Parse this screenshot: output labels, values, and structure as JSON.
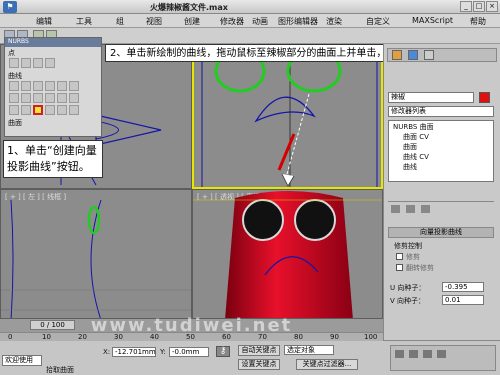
{
  "window": {
    "title": "火爆辣椒酱文件.max",
    "controls": [
      "_",
      "□",
      "×"
    ]
  },
  "menu": [
    "编辑",
    "工具",
    "组",
    "视图",
    "创建",
    "修改器",
    "动画",
    "图形编辑器",
    "渲染",
    "自定义",
    "MAXScript",
    "帮助"
  ],
  "palette": {
    "title": "NURBS",
    "sections": [
      "点",
      "曲线",
      "曲面"
    ]
  },
  "viewports": {
    "top_left": "",
    "top_right": "",
    "bottom_left": "[ + ] [ 左 ] [ 线框 ]",
    "bottom_right": "[ + ] [ 透视 ] [ 平滑 + 高光 ]"
  },
  "callouts": {
    "step1": "1、单击“创建向量投影曲线”按钮。",
    "step2": "2、单击新绘制的曲线，拖动鼠标至辣椒部分的曲面上并单击，在曲面投影。"
  },
  "cmdpanel": {
    "object_name": "辣椒",
    "modifier_list": "修改器列表",
    "stack": [
      "NURBS 曲面",
      "曲面 CV",
      "曲面",
      "曲线 CV",
      "曲线"
    ],
    "rollout_title": "向量投影曲线",
    "trim_group": "修剪控制",
    "trim_checkbox": "修剪",
    "flip_checkbox": "翻转修剪",
    "u_seed_label": "U 向种子：",
    "u_seed_value": "-0.395",
    "v_seed_label": "V 向种子：",
    "v_seed_value": "0.01"
  },
  "bottombar": {
    "timeline": "0 / 100",
    "ticks": [
      "0",
      "10",
      "20",
      "30",
      "40",
      "50",
      "60",
      "70",
      "80",
      "90",
      "100"
    ],
    "welcome": "欢迎使用",
    "status": "拾取曲面",
    "x_label": "X:",
    "x_value": "-12.701mm",
    "y_label": "Y:",
    "y_value": "-0.0mm",
    "auto_key": "自动关键点",
    "set_key": "设置关键点",
    "selected": "选定对象",
    "key_filter": "关键点过滤器..."
  },
  "watermark": "www.tudiwei.net"
}
